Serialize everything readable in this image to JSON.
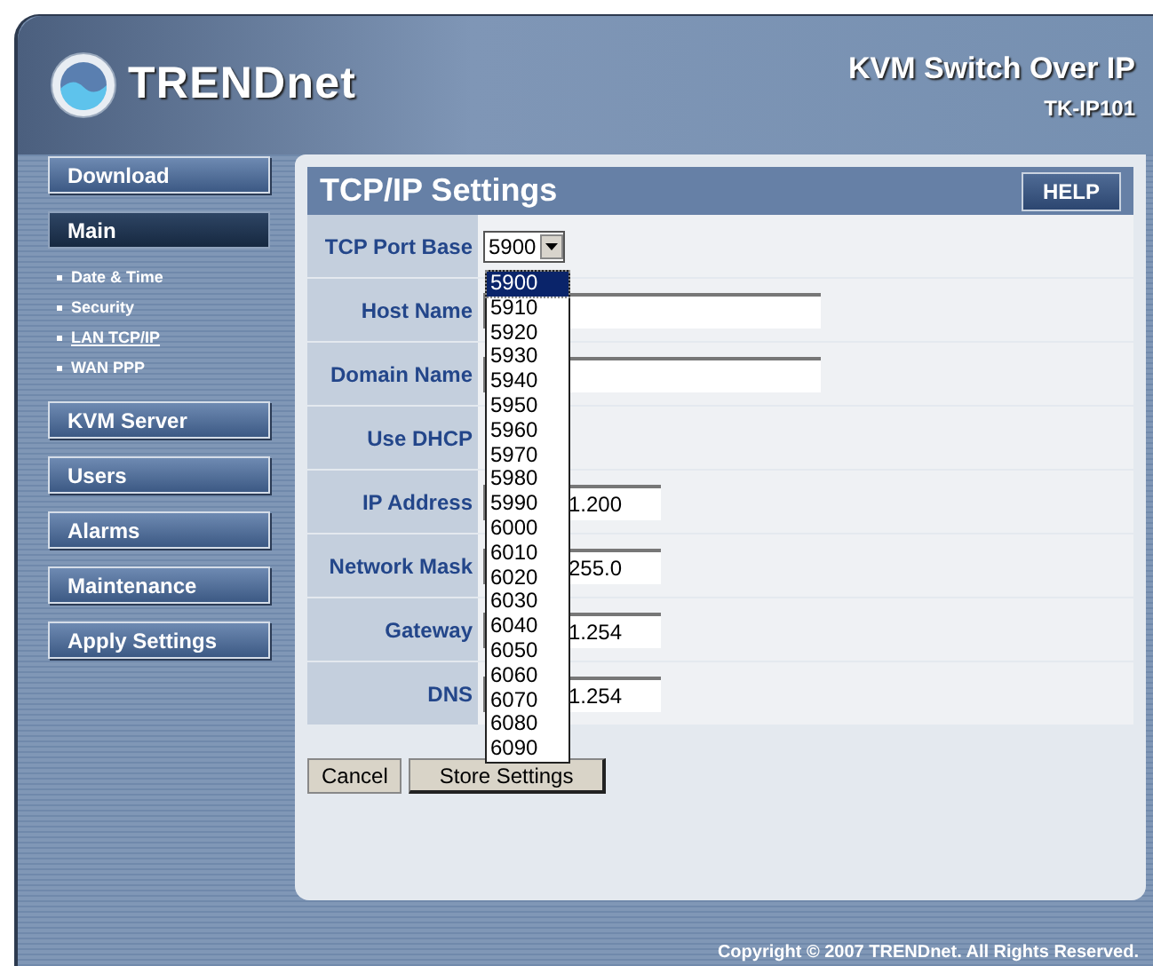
{
  "header": {
    "brand": "TRENDnet",
    "product": "KVM Switch Over IP",
    "model": "TK-IP101"
  },
  "sidebar": {
    "items": [
      {
        "label": "Download",
        "selected": false
      },
      {
        "label": "Main",
        "selected": true,
        "children": [
          {
            "label": "Date & Time",
            "selected": false
          },
          {
            "label": "Security",
            "selected": false
          },
          {
            "label": "LAN TCP/IP",
            "selected": true
          },
          {
            "label": "WAN PPP",
            "selected": false
          }
        ]
      },
      {
        "label": "KVM Server",
        "selected": false
      },
      {
        "label": "Users",
        "selected": false
      },
      {
        "label": "Alarms",
        "selected": false
      },
      {
        "label": "Maintenance",
        "selected": false
      },
      {
        "label": "Apply Settings",
        "selected": false
      }
    ]
  },
  "panel": {
    "title": "TCP/IP Settings",
    "help_button": "HELP"
  },
  "form": {
    "rows": [
      {
        "label": "TCP Port Base",
        "kind": "select",
        "value": "5900"
      },
      {
        "label": "Host Name",
        "kind": "text",
        "value": ""
      },
      {
        "label": "Domain Name",
        "kind": "text",
        "value": ""
      },
      {
        "label": "Use DHCP",
        "kind": "covered"
      },
      {
        "label": "IP Address",
        "kind": "short",
        "value": "1.200"
      },
      {
        "label": "Network Mask",
        "kind": "short",
        "value": "255.0"
      },
      {
        "label": "Gateway",
        "kind": "short",
        "value": "1.254"
      },
      {
        "label": "DNS",
        "kind": "short",
        "value": "1.254"
      }
    ]
  },
  "dropdown": {
    "options": [
      {
        "label": "5900",
        "selected": true
      },
      {
        "label": "5910",
        "selected": false
      },
      {
        "label": "5920",
        "selected": false
      },
      {
        "label": "5930",
        "selected": false
      },
      {
        "label": "5940",
        "selected": false
      },
      {
        "label": "5950",
        "selected": false
      },
      {
        "label": "5960",
        "selected": false
      },
      {
        "label": "5970",
        "selected": false
      },
      {
        "label": "5980",
        "selected": false
      },
      {
        "label": "5990",
        "selected": false
      },
      {
        "label": "6000",
        "selected": false
      },
      {
        "label": "6010",
        "selected": false
      },
      {
        "label": "6020",
        "selected": false
      },
      {
        "label": "6030",
        "selected": false
      },
      {
        "label": "6040",
        "selected": false
      },
      {
        "label": "6050",
        "selected": false
      },
      {
        "label": "6060",
        "selected": false
      },
      {
        "label": "6070",
        "selected": false
      },
      {
        "label": "6080",
        "selected": false
      },
      {
        "label": "6090",
        "selected": false
      }
    ]
  },
  "buttons": [
    "Cancel",
    "Store Settings"
  ],
  "footer": {
    "copyright": "Copyright © 2007 TRENDnet. All Rights Reserved."
  }
}
